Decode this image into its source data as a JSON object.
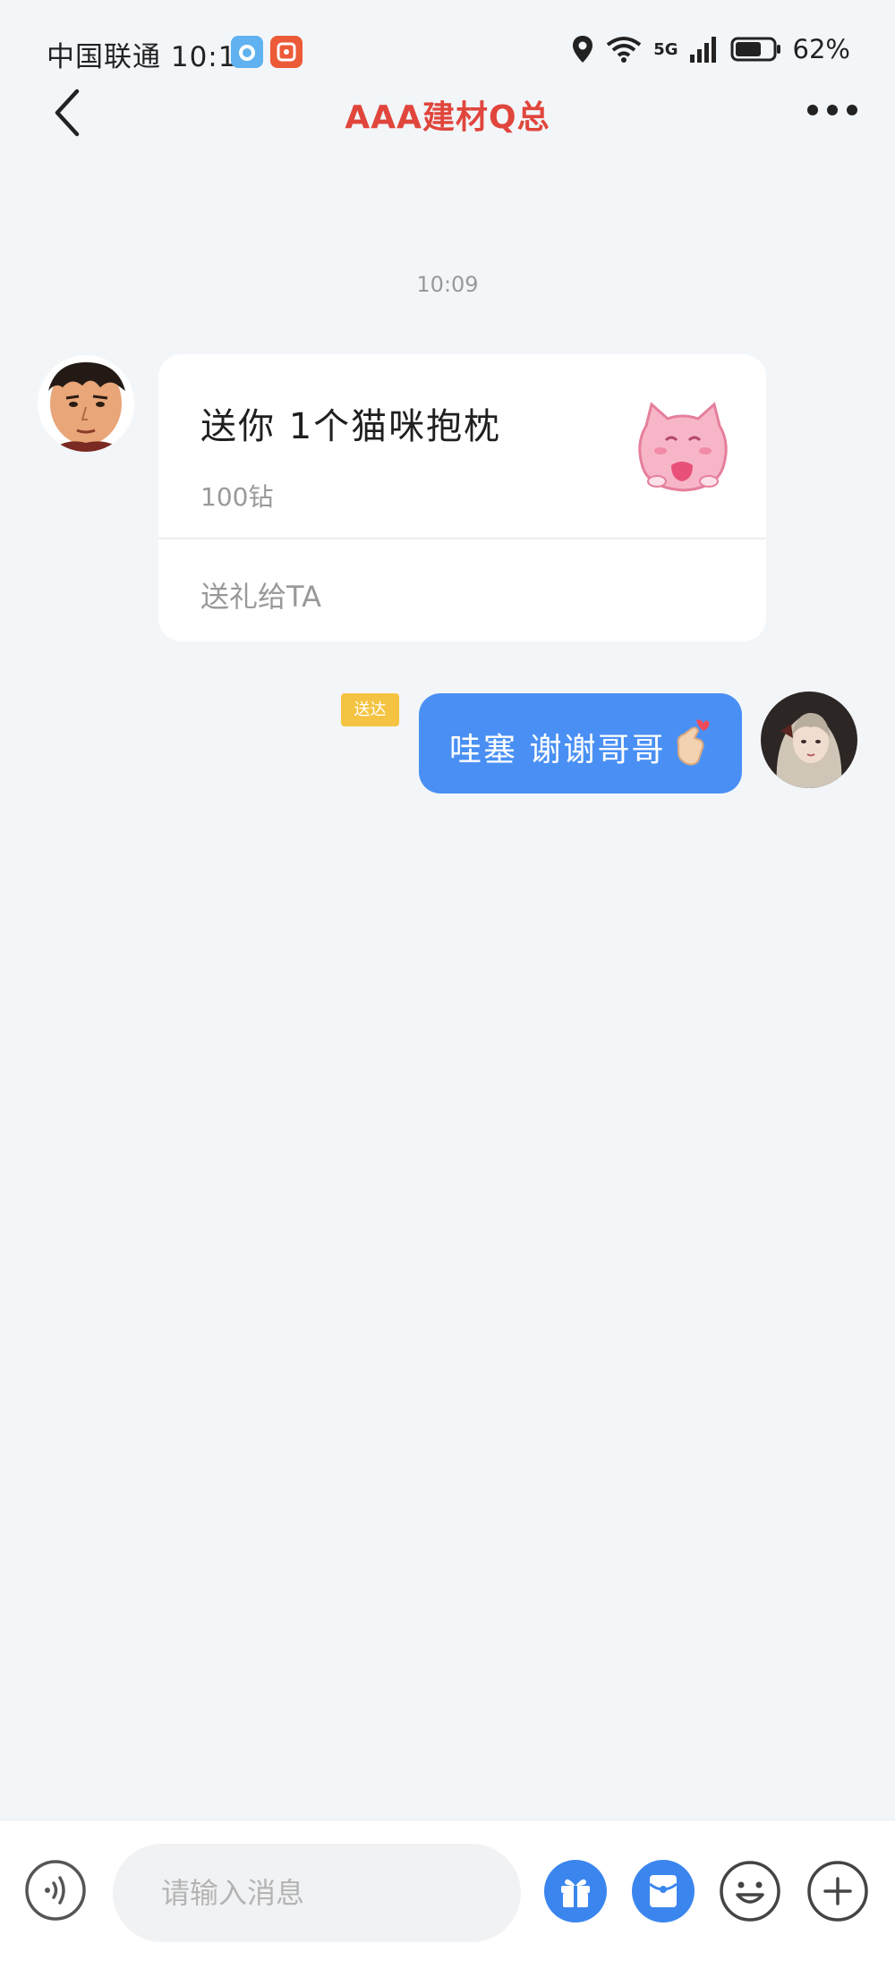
{
  "status_bar": {
    "carrier": "中国联通",
    "time": "10:10",
    "network": "5G",
    "battery": "62%"
  },
  "header": {
    "title": "AAA建材Q总"
  },
  "chat": {
    "timestamp": "10:09",
    "gift_card": {
      "title": "送你 1个猫咪抱枕",
      "price": "100钻",
      "action": "送礼给TA"
    },
    "my_message": {
      "read_label": "送达",
      "text": "哇塞 谢谢哥哥"
    }
  },
  "input_bar": {
    "placeholder": "请输入消息"
  },
  "colors": {
    "title": "#e0463c",
    "bubble": "#4a90f4",
    "badge": "#f4c341",
    "action_blue": "#3b86ee"
  }
}
